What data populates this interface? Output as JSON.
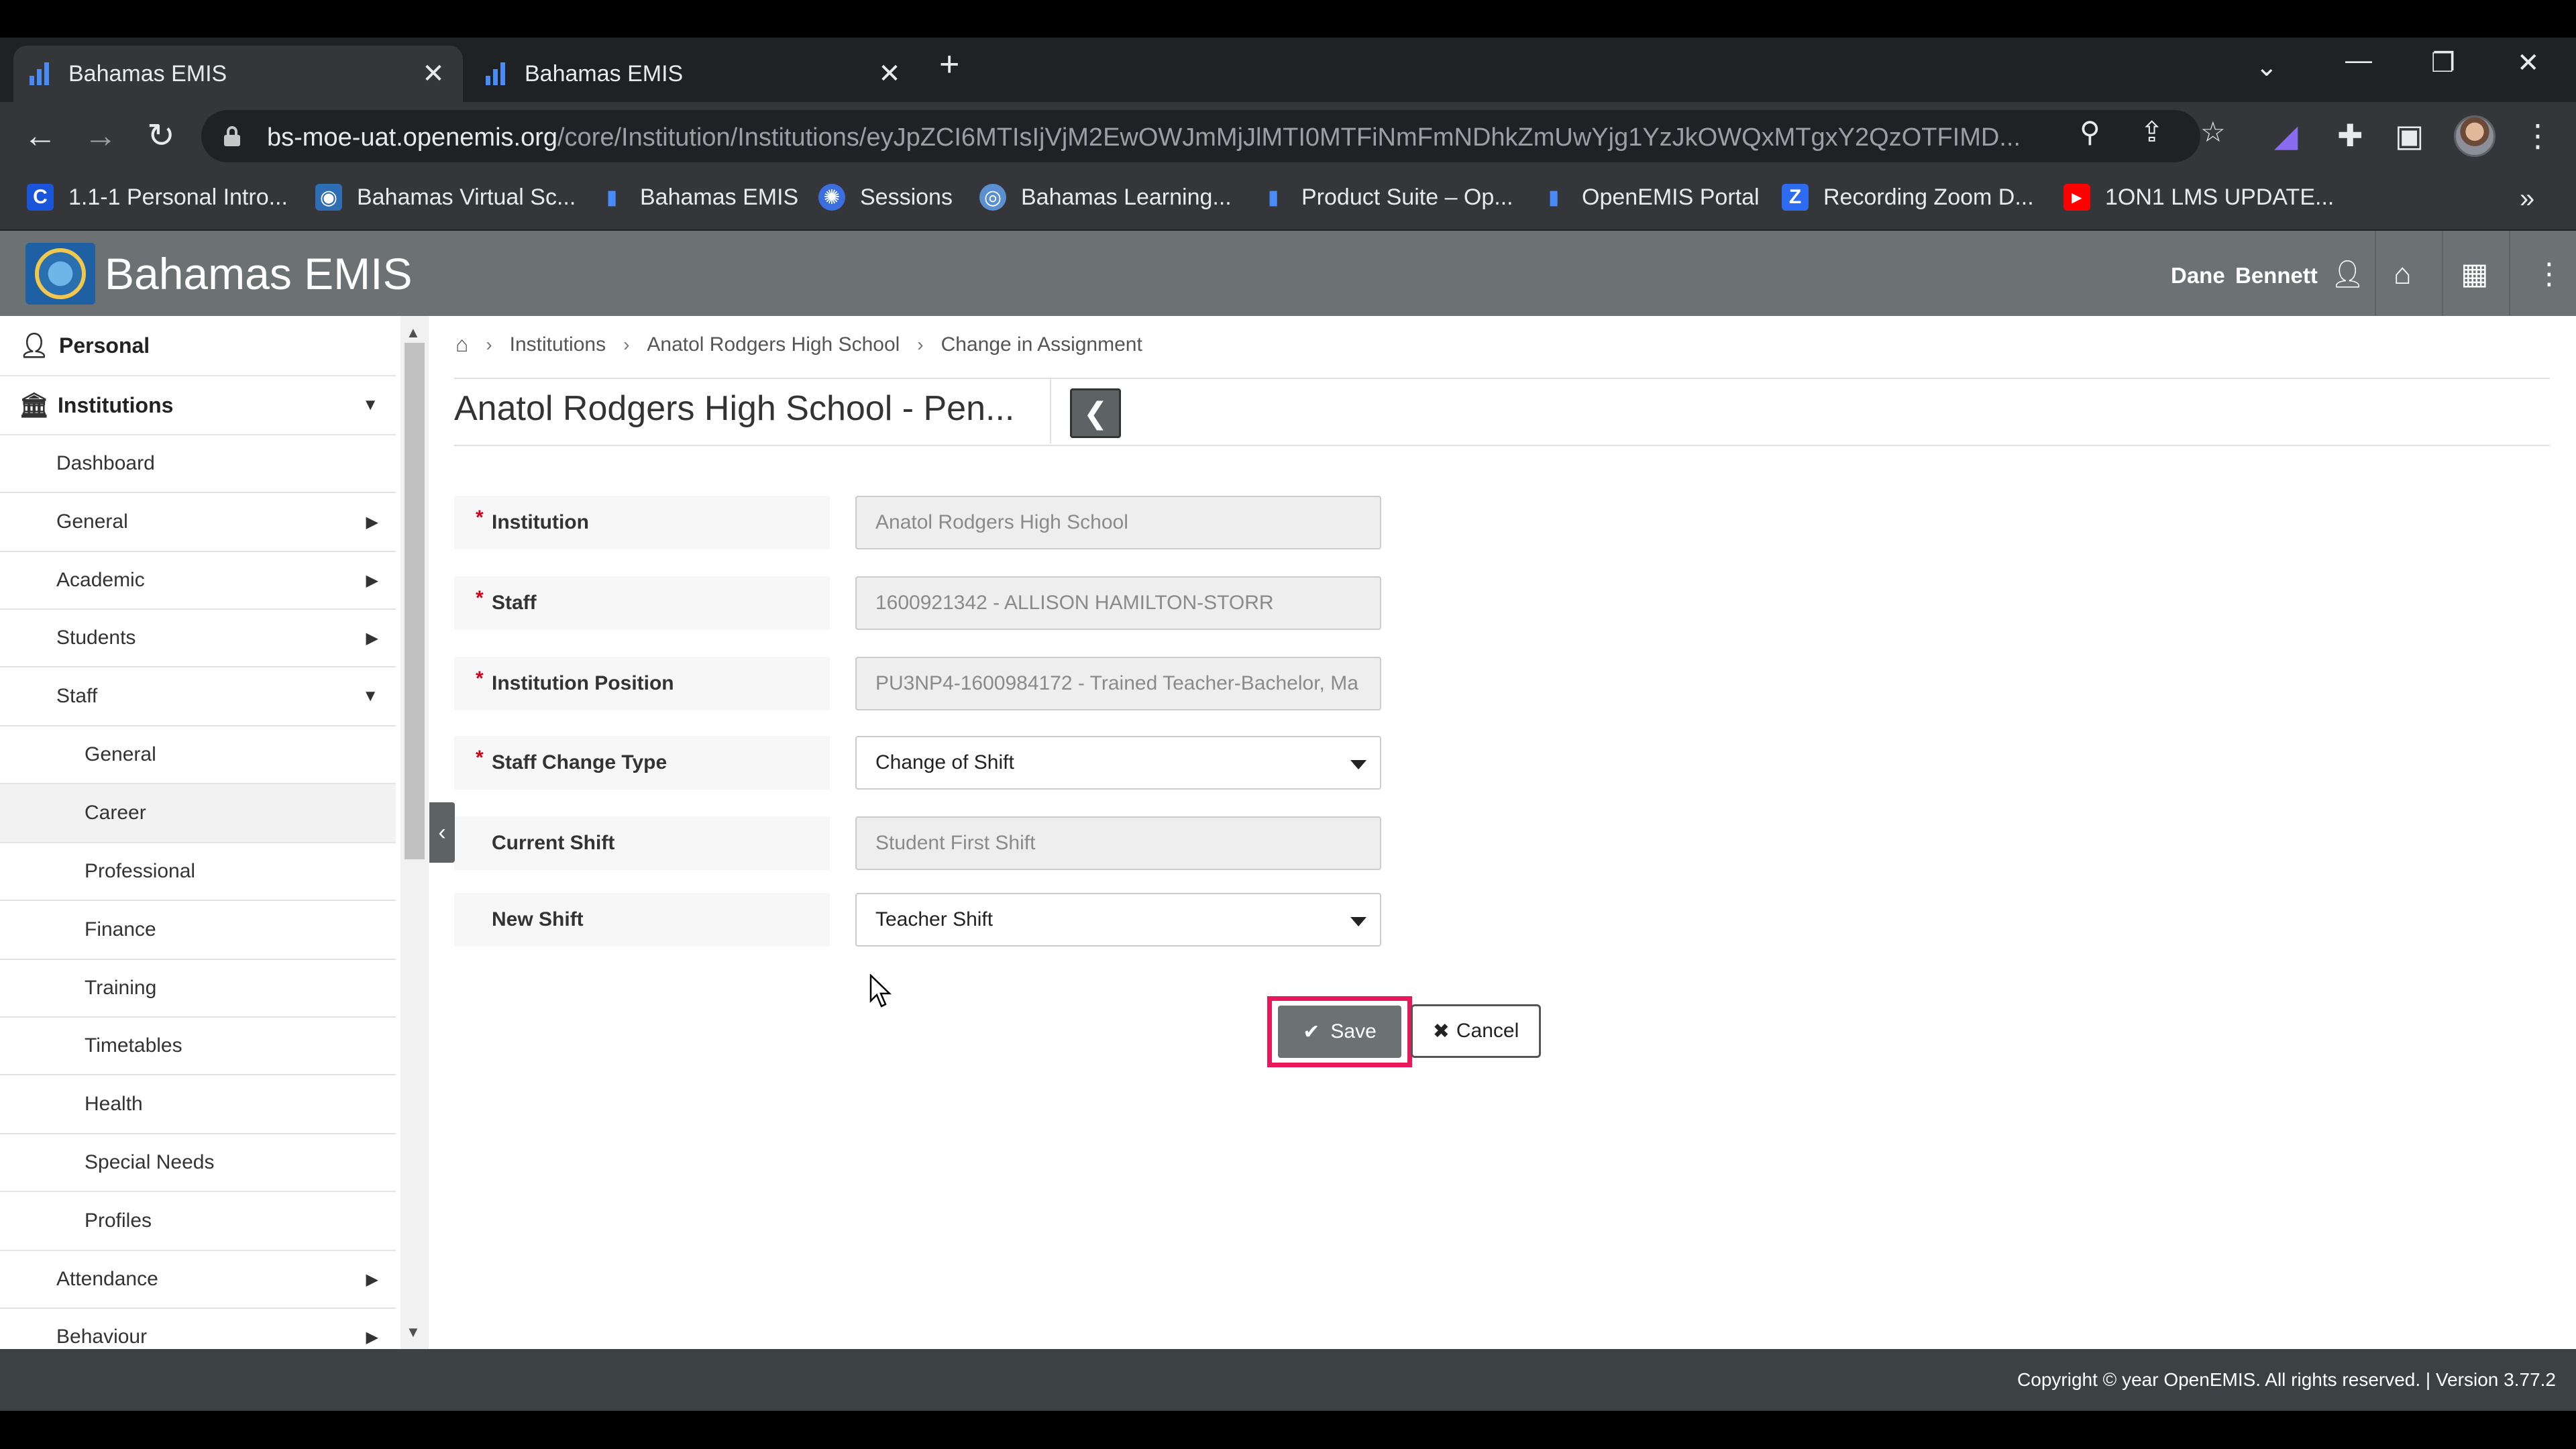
{
  "browser": {
    "tabs": [
      {
        "title": "Bahamas EMIS",
        "active": true
      },
      {
        "title": "Bahamas EMIS",
        "active": false
      }
    ],
    "url_host": "bs-moe-uat.openemis.org",
    "url_path": "/core/Institution/Institutions/eyJpZCI6MTIsIjVjM2EwOWJmMjJlMTI0MTFiNmFmNDhkZmUwYjg1YzJkOWQxMTgxY2QzOTFIMD...",
    "bookmarks": [
      {
        "label": "1.1-1 Personal Intro...",
        "icon": "c-logo-icon",
        "color": "#1a56db"
      },
      {
        "label": "Bahamas Virtual Sc...",
        "icon": "school-seal-icon",
        "color": "#2f6db5"
      },
      {
        "label": "Bahamas EMIS",
        "icon": "emis-bars-icon",
        "color": "#4a8cf7"
      },
      {
        "label": "Sessions",
        "icon": "gear-circle-icon",
        "color": "#3b6fe0"
      },
      {
        "label": "Bahamas Learning...",
        "icon": "learning-seal-icon",
        "color": "#5a8fd0"
      },
      {
        "label": "Product Suite – Op...",
        "icon": "emis-bars-icon",
        "color": "#4a8cf7"
      },
      {
        "label": "OpenEMIS Portal",
        "icon": "emis-bars-icon",
        "color": "#4a8cf7"
      },
      {
        "label": "Recording Zoom D...",
        "icon": "z-logo-icon",
        "color": "#2d6cf0"
      },
      {
        "label": "1ON1 LMS UPDATE...",
        "icon": "youtube-icon",
        "color": "#ff0000"
      }
    ]
  },
  "app": {
    "title": "Bahamas EMIS",
    "user_first": "Dane",
    "user_last": "Bennett"
  },
  "sidebar": {
    "items": [
      {
        "label": "Personal",
        "level": 0,
        "bold": true,
        "icon": "user-icon"
      },
      {
        "label": "Institutions",
        "level": 0,
        "bold": true,
        "icon": "institution-icon",
        "expanded": true
      },
      {
        "label": "Dashboard",
        "level": 1
      },
      {
        "label": "General",
        "level": 1,
        "submenu": true
      },
      {
        "label": "Academic",
        "level": 1,
        "submenu": true
      },
      {
        "label": "Students",
        "level": 1,
        "submenu": true
      },
      {
        "label": "Staff",
        "level": 1,
        "expanded": true
      },
      {
        "label": "General",
        "level": 2
      },
      {
        "label": "Career",
        "level": 2,
        "active": true
      },
      {
        "label": "Professional",
        "level": 2
      },
      {
        "label": "Finance",
        "level": 2
      },
      {
        "label": "Training",
        "level": 2
      },
      {
        "label": "Timetables",
        "level": 2
      },
      {
        "label": "Health",
        "level": 2
      },
      {
        "label": "Special Needs",
        "level": 2
      },
      {
        "label": "Profiles",
        "level": 2
      },
      {
        "label": "Attendance",
        "level": 1,
        "submenu": true
      },
      {
        "label": "Behaviour",
        "level": 1,
        "submenu": true
      }
    ]
  },
  "breadcrumb": [
    "Institutions",
    "Anatol Rodgers High School",
    "Change in Assignment"
  ],
  "page_title": "Anatol Rodgers High School - Pen...",
  "form": {
    "fields": [
      {
        "label": "Institution",
        "required": true,
        "value": "Anatol Rodgers High School",
        "type": "readonly"
      },
      {
        "label": "Staff",
        "required": true,
        "value": "1600921342 - ALLISON HAMILTON-STORR",
        "type": "readonly"
      },
      {
        "label": "Institution Position",
        "required": true,
        "value": "PU3NP4-1600984172 - Trained Teacher-Bachelor, Ma",
        "type": "readonly"
      },
      {
        "label": "Staff Change Type",
        "required": true,
        "value": "Change of Shift",
        "type": "select"
      },
      {
        "label": "Current Shift",
        "required": false,
        "value": "Student First Shift",
        "type": "readonly"
      },
      {
        "label": "New Shift",
        "required": false,
        "value": "Teacher Shift",
        "type": "select"
      }
    ],
    "save_label": "Save",
    "cancel_label": "Cancel"
  },
  "footer": {
    "text": "Copyright © year OpenEMIS. All rights reserved. | Version 3.77.2"
  },
  "colors": {
    "header_bg": "#6c7274",
    "highlight": "#e8185a",
    "required": "#d0021b"
  }
}
